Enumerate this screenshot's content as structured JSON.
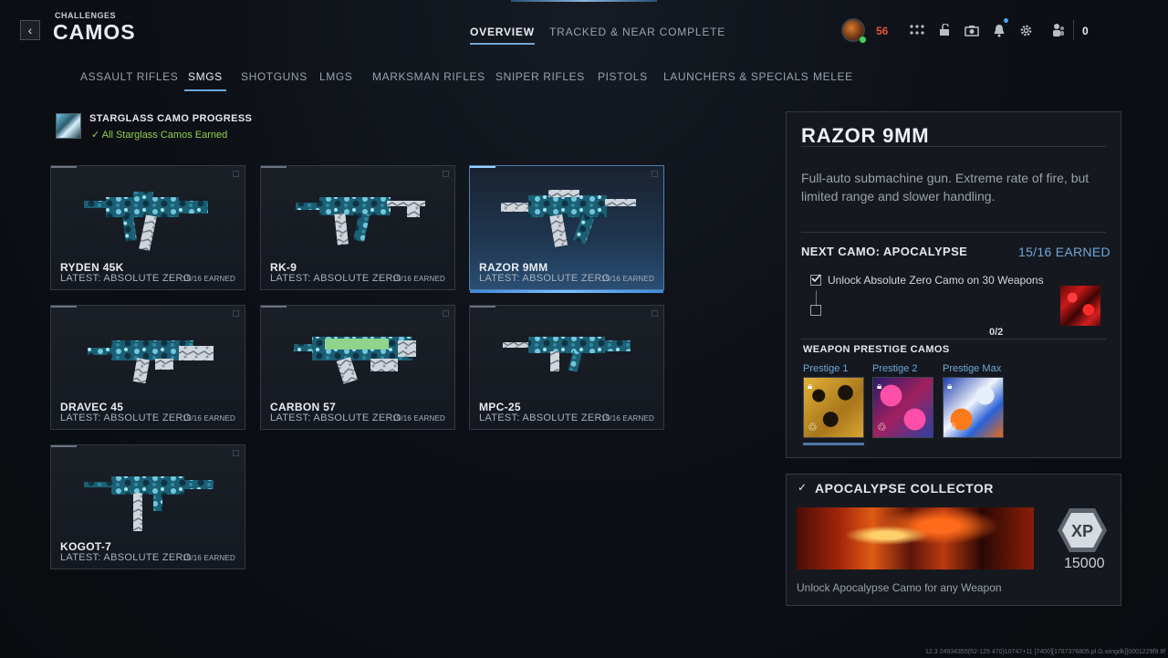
{
  "header": {
    "crumb": "CHALLENGES",
    "title": "CAMOS",
    "tabs": [
      {
        "label": "OVERVIEW",
        "active": true
      },
      {
        "label": "TRACKED & NEAR COMPLETE",
        "active": false
      }
    ],
    "level": "56",
    "currency": "0",
    "icons": [
      "grid-icon",
      "unlock-icon",
      "camera-icon",
      "bell-icon",
      "gear-icon",
      "party-icon"
    ]
  },
  "categories": [
    {
      "label": "ASSAULT RIFLES",
      "active": false
    },
    {
      "label": "SMGS",
      "active": true
    },
    {
      "label": "SHOTGUNS",
      "active": false
    },
    {
      "label": "LMGS",
      "active": false
    },
    {
      "label": "MARKSMAN RIFLES",
      "active": false
    },
    {
      "label": "SNIPER RIFLES",
      "active": false
    },
    {
      "label": "PISTOLS",
      "active": false
    },
    {
      "label": "LAUNCHERS & SPECIALS",
      "active": false
    },
    {
      "label": "MELEE",
      "active": false
    }
  ],
  "starglass": {
    "title": "STARGLASS CAMO PROGRESS",
    "status": "All Starglass Camos Earned",
    "status_color": "#8fd14f"
  },
  "weapons": [
    {
      "name": "RYDEN 45K",
      "latest": "LATEST: ABSOLUTE ZERO",
      "earned": "15/16 EARNED",
      "selected": false
    },
    {
      "name": "RK-9",
      "latest": "LATEST: ABSOLUTE ZERO",
      "earned": "15/16 EARNED",
      "selected": false
    },
    {
      "name": "RAZOR 9MM",
      "latest": "LATEST: ABSOLUTE ZERO",
      "earned": "15/16 EARNED",
      "selected": true
    },
    {
      "name": "DRAVEC 45",
      "latest": "LATEST: ABSOLUTE ZERO",
      "earned": "15/16 EARNED",
      "selected": false
    },
    {
      "name": "CARBON 57",
      "latest": "LATEST: ABSOLUTE ZERO",
      "earned": "15/16 EARNED",
      "selected": false
    },
    {
      "name": "MPC-25",
      "latest": "LATEST: ABSOLUTE ZERO",
      "earned": "15/16 EARNED",
      "selected": false
    },
    {
      "name": "KOGOT-7",
      "latest": "LATEST: ABSOLUTE ZERO",
      "earned": "15/16 EARNED",
      "selected": false
    }
  ],
  "detail": {
    "title": "RAZOR 9MM",
    "description": "Full-auto submachine gun. Extreme rate of fire, but limited range and slower handling.",
    "next_camo": "NEXT CAMO: APOCALYPSE",
    "earned": "15/16 EARNED",
    "task": "Unlock Absolute Zero Camo on 30 Weapons",
    "task_progress": "0/2",
    "prestige_heading": "WEAPON PRESTIGE CAMOS",
    "prestige": [
      "Prestige 1",
      "Prestige 2",
      "Prestige Max"
    ]
  },
  "collector": {
    "title": "APOCALYPSE COLLECTOR",
    "xp_label": "XP",
    "xp_amount": "15000",
    "description": "Unlock Apocalypse Camo for any Weapon"
  },
  "build_info": "12.3 24934355(52-125 470)10747+11 [7400][1787376805.pl.G.wingdk][0001229f9 8f",
  "colors": {
    "accent": "#6fa6d8",
    "level": "#e5503b",
    "success": "#8fd14f"
  }
}
